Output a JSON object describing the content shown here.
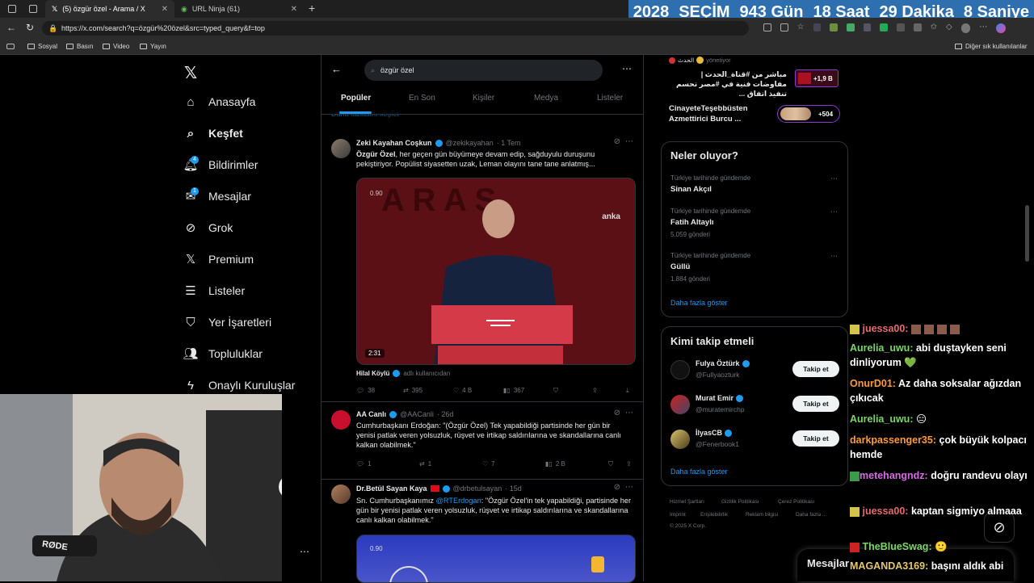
{
  "browser": {
    "tabs": [
      {
        "title": "(5) özgür özel - Arama / X"
      },
      {
        "title": "URL Ninja (61)"
      }
    ],
    "url": "https://x.com/search?q=özgür%20özel&src=typed_query&f=top",
    "bookmarks": [
      "Sosyal",
      "Basın",
      "Video",
      "Yayın"
    ],
    "other_bookmarks": "Diğer sık kullanılanlar"
  },
  "countdown": {
    "year": "2028",
    "label": "SEÇİM",
    "days": "943 Gün",
    "hours": "18 Saat",
    "minutes": "29 Dakika",
    "seconds": "8 Saniye"
  },
  "nav": {
    "items": [
      {
        "label": "Anasayfa"
      },
      {
        "label": "Keşfet"
      },
      {
        "label": "Bildirimler",
        "badge": "4"
      },
      {
        "label": "Mesajlar",
        "badge": "1"
      },
      {
        "label": "Grok"
      },
      {
        "label": "Premium"
      },
      {
        "label": "Listeler"
      },
      {
        "label": "Yer İşaretleri"
      },
      {
        "label": "Topluluklar"
      },
      {
        "label": "Onaylı Kuruluşlar"
      }
    ]
  },
  "search": {
    "query": "özgür özel",
    "tabs": [
      "Popüler",
      "En Son",
      "Kişiler",
      "Medya",
      "Listeler"
    ],
    "partial_link": "Daha fazlasını keşfet"
  },
  "tweets": [
    {
      "name": "Zeki Kayahan Coşkun",
      "handle": "@zekikayahan",
      "time": "· 1 Tem",
      "text_bold": "Özgür Özel",
      "text": ", her geçen gün büyümeye devam edip, sağduyulu duruşunu pekiştiriyor. Popülist siyasetten uzak, Leman olayını tane tane anlatmış...",
      "media_duration": "2:31",
      "media_badge": "0.90",
      "media_logo": "anka",
      "credit_name": "Hilal Köylü",
      "credit_handle": "adlı kullanıcıdan",
      "replies": "38",
      "retweets": "395",
      "likes": "4 B",
      "views": "367"
    },
    {
      "name": "AA Canlı",
      "handle": "@AACanli",
      "time": "· 26d",
      "text": "Cumhurbaşkanı Erdoğan: \"(Özgür Özel) Tek yapabildiği partisinde her gün bir yenisi patlak veren yolsuzluk, rüşvet ve irtikap saldırılarına ve skandallarına canlı kalkan olabilmek.\"",
      "replies": "1",
      "retweets": "1",
      "likes": "7",
      "views": "2 B"
    },
    {
      "name": "Dr.Betül Sayan Kaya",
      "handle": "@drbetulsayan",
      "time": "· 15d",
      "text_prefix": "Sn. Cumhurbaşkanımız ",
      "mention": "@RTErdogan",
      "text": ": \"Özgür Özel'in tek yapabildiği, partisinde her gün bir yenisi patlak veren yolsuzluk, rüşvet ve irtikap saldırılarına ve skandallarına canlı kalkan olabilmek.\"",
      "media_badge": "0.90"
    }
  ],
  "right": {
    "top_items": [
      {
        "name": "الحدث",
        "tag": "yönetiyor",
        "text": "مباشر من #قناة_الحدث | مفاوضات فنية في #مصر تحسم تنفيذ اتفاق ...",
        "count": "+1,9 B"
      },
      {
        "text": "CinayeteTeşebbüsten Azmettirici Burcu ...",
        "count": "+504"
      }
    ],
    "trends_title": "Neler oluyor?",
    "trends": [
      {
        "context": "Türkiye tarihinde gündemde",
        "title": "Sinan Akçıl",
        "posts": ""
      },
      {
        "context": "Türkiye tarihinde gündemde",
        "title": "Fatih Altaylı",
        "posts": "5.059 gönderi"
      },
      {
        "context": "Türkiye tarihinde gündemde",
        "title": "Güllü",
        "posts": "1.884 gönderi"
      }
    ],
    "trends_more": "Daha fazla göster",
    "follow_title": "Kimi takip etmeli",
    "follow": [
      {
        "name": "Fulya Öztürk",
        "handle": "@Fullyaozturk",
        "btn": "Takip et"
      },
      {
        "name": "Murat Emir",
        "handle": "@muratemirchp",
        "btn": "Takip et"
      },
      {
        "name": "İlyasCB",
        "handle": "@Fenerbook1",
        "btn": "Takip et"
      }
    ],
    "follow_more": "Daha fazla göster",
    "footer": [
      "Hizmet Şartları",
      "Gizlilik Politikası",
      "Çerez Politikası",
      "Imprint",
      "Erişilebilirlik",
      "Reklam bilgisi",
      "Daha fazla ...",
      "© 2025 X Corp."
    ]
  },
  "messages_bar": "Mesajlar",
  "chat": [
    {
      "user": "juessa00:",
      "msg": "",
      "color": "#e36b6b"
    },
    {
      "user": "Aurelia_uwu:",
      "msg": "abi duştayken seni dinliyorum 💚",
      "color": "#7cd36b"
    },
    {
      "user": "OnurD01:",
      "msg": "Az daha soksalar ağızdan çıkıcak",
      "color": "#ff9a3c"
    },
    {
      "user": "Aurelia_uwu:",
      "msg": "😑",
      "color": "#7cd36b"
    },
    {
      "user": "darkpassenger35:",
      "msg": "çok büyük kolpacı hemde",
      "color": "#ff9a3c"
    },
    {
      "user": "metehangndz:",
      "msg": "doğru randevu olayı",
      "color": "#d66be3"
    },
    {
      "user": "juessa00:",
      "msg": "kaptan sigmiyo almaaa",
      "color": "#e36b6b"
    },
    {
      "user": "TheBlueSwag:",
      "msg": "🙂",
      "color": "#7cd36b"
    },
    {
      "user": "MAGANDA3169:",
      "msg": "başını aldık abi",
      "color": "#e3c86b"
    }
  ],
  "webcam": {
    "mic_brand": "RØDE"
  }
}
